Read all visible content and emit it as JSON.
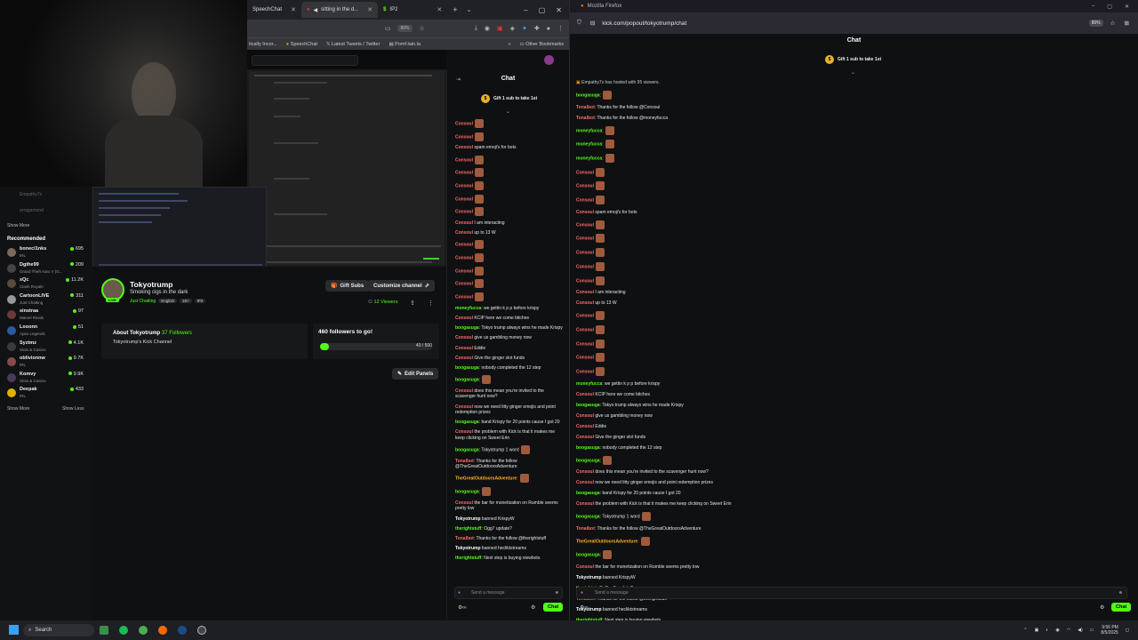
{
  "left_browser": {
    "tabs": [
      {
        "label": "SpeechChat",
        "active": false
      },
      {
        "label": "sitting in the d...",
        "active": true
      },
      {
        "label": "IP2",
        "active": false
      }
    ],
    "zoom": "80%",
    "bookmarks": [
      "tically Incor...",
      "SpeechChat",
      "Latest Tweets / Twitter",
      "Pomf.lain.la",
      "Other Bookmarks"
    ]
  },
  "sidebar": {
    "followed": [
      "Empathy7x",
      "erragamond"
    ],
    "show_more_top": "Show More",
    "recommended_title": "Recommended",
    "recommended": [
      {
        "name": "bonecl1nks",
        "game": "IRL",
        "count": "695",
        "color": "#7a6a5a"
      },
      {
        "name": "Dgthe99",
        "game": "Grand Theft Auto V (G...",
        "count": "209",
        "color": "#444"
      },
      {
        "name": "xQc",
        "game": "Clash Royale",
        "count": "11.2K",
        "color": "#5a4a3a"
      },
      {
        "name": "CartoonLIVE",
        "game": "Just Chatting",
        "count": "311",
        "color": "#999"
      },
      {
        "name": "sinstraa",
        "game": "Marvel Rivals",
        "count": "97",
        "color": "#6a3a3a"
      },
      {
        "name": "Looonn",
        "game": "Apex Legends",
        "count": "51",
        "color": "#2a5aa0"
      },
      {
        "name": "Syztmz",
        "game": "Slots & Casino",
        "count": "4.1K",
        "color": "#3a3a3a"
      },
      {
        "name": "oblivionnw",
        "game": "IRL",
        "count": "9.7K",
        "color": "#8a4a4a"
      },
      {
        "name": "Komvy",
        "game": "Slots & Casino",
        "count": "9.9K",
        "color": "#4a3a5a"
      },
      {
        "name": "Deepak",
        "game": "IRL",
        "count": "433",
        "color": "#e0b000"
      }
    ],
    "show_more": "Show More",
    "show_less": "Show Less"
  },
  "channel": {
    "name": "Tokyotrump",
    "title": "Smoking cigs in the dark",
    "category": "Just Chatting",
    "tags": [
      "English",
      "18+",
      "IP2"
    ],
    "live": "LIVE",
    "gift_subs": "Gift Subs",
    "customize": "Customize channel",
    "viewers": "12 Viewers",
    "about_title": "About Tokyotrump",
    "followers": "37 Followers",
    "about_text": "Tokyotrump's Kick Channel",
    "goal_title": "460 followers to go!",
    "goal_count": "40 / 500",
    "goal_fraction": 0.08,
    "edit_panels": "Edit Panels"
  },
  "left_chat": {
    "title": "Chat",
    "pinned": "Gift 1 sub to take 1st",
    "messages": [
      {
        "user": "Consoul",
        "text": "",
        "emote": true,
        "color": "#ff6b6b"
      },
      {
        "user": "Consoul",
        "text": "",
        "emote": true,
        "color": "#ff6b6b"
      },
      {
        "user": "Consoul",
        "text": " spam emoji's for bots",
        "emote": false,
        "color": "#ff6b6b"
      },
      {
        "user": "Consoul",
        "text": "",
        "emote": true,
        "color": "#ff6b6b"
      },
      {
        "user": "Consoul",
        "text": "",
        "emote": true,
        "color": "#ff6b6b"
      },
      {
        "user": "Consoul",
        "text": "",
        "emote": true,
        "color": "#ff6b6b"
      },
      {
        "user": "Consoul",
        "text": "",
        "emote": true,
        "color": "#ff6b6b"
      },
      {
        "user": "Consoul",
        "text": "",
        "emote": true,
        "color": "#ff6b6b"
      },
      {
        "user": "Consoul",
        "text": " I am interacting",
        "emote": false,
        "color": "#ff6b6b"
      },
      {
        "user": "Consoul",
        "text": " up to 13 W",
        "emote": false,
        "color": "#ff6b6b"
      },
      {
        "user": "Consoul",
        "text": "",
        "emote": true,
        "color": "#ff6b6b"
      },
      {
        "user": "Consoul",
        "text": "",
        "emote": true,
        "color": "#ff6b6b"
      },
      {
        "user": "Consoul",
        "text": "",
        "emote": true,
        "color": "#ff6b6b"
      },
      {
        "user": "Consoul",
        "text": "",
        "emote": true,
        "color": "#ff6b6b"
      },
      {
        "user": "Consoul",
        "text": "",
        "emote": true,
        "color": "#ff6b6b"
      },
      {
        "user": "moneyfucca",
        "text": ": we gettin k p p before krispy",
        "emote": false,
        "color": "#53fc18"
      },
      {
        "user": "Consoul",
        "text": " KCIP here we come bitches",
        "emote": false,
        "color": "#ff6b6b"
      },
      {
        "user": "boogasuga",
        "text": ": Tokyo trump always wins he made Krispy",
        "emote": false,
        "color": "#53fc18"
      },
      {
        "user": "Consoul",
        "text": " give us gambling money now",
        "emote": false,
        "color": "#ff6b6b"
      },
      {
        "user": "Consoul",
        "text": " Eddie",
        "emote": false,
        "color": "#ff6b6b"
      },
      {
        "user": "Consoul",
        "text": " Give the ginger slot funds",
        "emote": false,
        "color": "#ff6b6b"
      },
      {
        "user": "boogasuga",
        "text": ": nobody completed the 12 step",
        "emote": false,
        "color": "#53fc18"
      },
      {
        "user": "boogasuga",
        "text": ":",
        "emote": true,
        "color": "#53fc18"
      },
      {
        "user": "Consoul",
        "text": " does this mean you're invited to the scavenger hunt now?",
        "emote": false,
        "color": "#ff6b6b"
      },
      {
        "user": "Consoul",
        "text": " now we need litty ginger emojis and point redemption prizes",
        "emote": false,
        "color": "#ff6b6b"
      },
      {
        "user": "boogasuga",
        "text": ": band Krispy for 20 points cause I got 20",
        "emote": false,
        "color": "#53fc18"
      },
      {
        "user": "Consoul",
        "text": " the problem with Kick is that it makes me keep clicking on Sweet Erin",
        "emote": false,
        "color": "#ff6b6b"
      },
      {
        "user": "boogasuga",
        "text": ": Tokyotrump 1 word",
        "emote": true,
        "color": "#53fc18"
      },
      {
        "user": "Tonalbot",
        "text": ": Thanks for the follow @TheGreatOutdoorsAdventure",
        "emote": false,
        "color": "#ff6b6b"
      },
      {
        "user": "TheGreatOutdoorsAdventure",
        "text": ":",
        "emote": true,
        "color": "#ffb020"
      },
      {
        "user": "boogasuga",
        "text": ":",
        "emote": true,
        "color": "#53fc18"
      },
      {
        "user": "Consoul",
        "text": " the bar for monetization on Rumble seems pretty low",
        "emote": false,
        "color": "#ff6b6b"
      },
      {
        "user": "Tokyotrump",
        "text": " banned KrispyW",
        "emote": false,
        "color": "#ffffff"
      },
      {
        "user": "therightstuff",
        "text": ": Ogg7 update?",
        "emote": false,
        "color": "#53fc18"
      },
      {
        "user": "Tonalbot",
        "text": ": Thanks for the follow @therightstuff",
        "emote": false,
        "color": "#ff6b6b"
      },
      {
        "user": "Tokyotrump",
        "text": " banned hecliktstreams",
        "emote": false,
        "color": "#ffffff"
      },
      {
        "user": "therightstuff",
        "text": ": Next step is buying viewbots",
        "emote": false,
        "color": "#53fc18"
      }
    ],
    "input_placeholder": "Send a message",
    "send_label": "Chat"
  },
  "right_browser": {
    "window_title": "Mozilla Firefox",
    "url": "kick.com/popout/tokyotrump/chat",
    "zoom": "80%"
  },
  "right_chat": {
    "title": "Chat",
    "pinned": "Gift 1 sub to take 1st",
    "host_notice": "Empathy7x has hosted with 95 viewers.",
    "messages": [
      {
        "user": "boogasuga",
        "text": ":",
        "emote": true,
        "color": "#53fc18"
      },
      {
        "user": "Tonalbot",
        "text": ": Thanks for the follow @Consoul",
        "emote": false,
        "color": "#ff6b6b"
      },
      {
        "user": "Tonalbot",
        "text": ": Thanks for the follow @moneyfucca",
        "emote": false,
        "color": "#ff6b6b"
      },
      {
        "user": "moneyfucca",
        "text": ":",
        "emote": true,
        "color": "#53fc18"
      },
      {
        "user": "moneyfucca",
        "text": ":",
        "emote": true,
        "color": "#53fc18"
      },
      {
        "user": "moneyfucca",
        "text": ":",
        "emote": true,
        "color": "#53fc18"
      },
      {
        "user": "Consoul",
        "text": "",
        "emote": true,
        "color": "#ff6b6b"
      },
      {
        "user": "Consoul",
        "text": "",
        "emote": true,
        "color": "#ff6b6b"
      },
      {
        "user": "Consoul",
        "text": "",
        "emote": true,
        "color": "#ff6b6b"
      },
      {
        "user": "Consoul",
        "text": " spam emoji's for bots",
        "emote": false,
        "color": "#ff6b6b"
      },
      {
        "user": "Consoul",
        "text": "",
        "emote": true,
        "color": "#ff6b6b"
      },
      {
        "user": "Consoul",
        "text": "",
        "emote": true,
        "color": "#ff6b6b"
      },
      {
        "user": "Consoul",
        "text": "",
        "emote": true,
        "color": "#ff6b6b"
      },
      {
        "user": "Consoul",
        "text": "",
        "emote": true,
        "color": "#ff6b6b"
      },
      {
        "user": "Consoul",
        "text": "",
        "emote": true,
        "color": "#ff6b6b"
      },
      {
        "user": "Consoul",
        "text": " I am interacting",
        "emote": false,
        "color": "#ff6b6b"
      },
      {
        "user": "Consoul",
        "text": " up to 13 W",
        "emote": false,
        "color": "#ff6b6b"
      },
      {
        "user": "Consoul",
        "text": "",
        "emote": true,
        "color": "#ff6b6b"
      },
      {
        "user": "Consoul",
        "text": "",
        "emote": true,
        "color": "#ff6b6b"
      },
      {
        "user": "Consoul",
        "text": "",
        "emote": true,
        "color": "#ff6b6b"
      },
      {
        "user": "Consoul",
        "text": "",
        "emote": true,
        "color": "#ff6b6b"
      },
      {
        "user": "Consoul",
        "text": "",
        "emote": true,
        "color": "#ff6b6b"
      },
      {
        "user": "moneyfucca",
        "text": ": we gettin k p p before krispy",
        "emote": false,
        "color": "#53fc18"
      },
      {
        "user": "Consoul",
        "text": " KCIP here we come bitches",
        "emote": false,
        "color": "#ff6b6b"
      },
      {
        "user": "boogasuga",
        "text": ": Tokyo trump always wins he made Krispy",
        "emote": false,
        "color": "#53fc18"
      },
      {
        "user": "Consoul",
        "text": " give us gambling money now",
        "emote": false,
        "color": "#ff6b6b"
      },
      {
        "user": "Consoul",
        "text": " Eddie",
        "emote": false,
        "color": "#ff6b6b"
      },
      {
        "user": "Consoul",
        "text": " Give the ginger slot funds",
        "emote": false,
        "color": "#ff6b6b"
      },
      {
        "user": "boogasuga",
        "text": ": nobody completed the 12 step",
        "emote": false,
        "color": "#53fc18"
      },
      {
        "user": "boogasuga",
        "text": ":",
        "emote": true,
        "color": "#53fc18"
      },
      {
        "user": "Consoul",
        "text": " does this mean you're invited to the scavenger hunt now?",
        "emote": false,
        "color": "#ff6b6b"
      },
      {
        "user": "Consoul",
        "text": " now we need litty ginger emojis and point redemption prizes",
        "emote": false,
        "color": "#ff6b6b"
      },
      {
        "user": "boogasuga",
        "text": ": band Krispy for 20 points cause I got 20",
        "emote": false,
        "color": "#53fc18"
      },
      {
        "user": "Consoul",
        "text": " the problem with Kick is that it makes me keep clicking on Sweet Erin",
        "emote": false,
        "color": "#ff6b6b"
      },
      {
        "user": "boogasuga",
        "text": ": Tokyotrump 1 word",
        "emote": true,
        "color": "#53fc18"
      },
      {
        "user": "Tonalbot",
        "text": ": Thanks for the follow @TheGreatOutdoorsAdventure",
        "emote": false,
        "color": "#ff6b6b"
      },
      {
        "user": "TheGreatOutdoorsAdventure",
        "text": ":",
        "emote": true,
        "color": "#ffb020"
      },
      {
        "user": "boogasuga",
        "text": ":",
        "emote": true,
        "color": "#53fc18"
      },
      {
        "user": "Consoul",
        "text": " the bar for monetization on Rumble seems pretty low",
        "emote": false,
        "color": "#ff6b6b"
      },
      {
        "user": "Tokyotrump",
        "text": " banned KrispyW",
        "emote": false,
        "color": "#ffffff"
      },
      {
        "user": "therightstuff",
        "text": ": Ogg7 update?",
        "emote": false,
        "color": "#53fc18"
      },
      {
        "user": "Tonalbot",
        "text": ": Thanks for the follow @therightstuff",
        "emote": false,
        "color": "#ff6b6b"
      },
      {
        "user": "Tokyotrump",
        "text": " banned hecliktstreams",
        "emote": false,
        "color": "#ffffff"
      },
      {
        "user": "therightstuff",
        "text": ": Next step is buying viewbots",
        "emote": false,
        "color": "#53fc18"
      }
    ],
    "input_placeholder": "Send a message",
    "send_label": "Chat"
  },
  "taskbar": {
    "search_label": "Search",
    "time": "9:56 PM",
    "date": "8/5/2025"
  }
}
